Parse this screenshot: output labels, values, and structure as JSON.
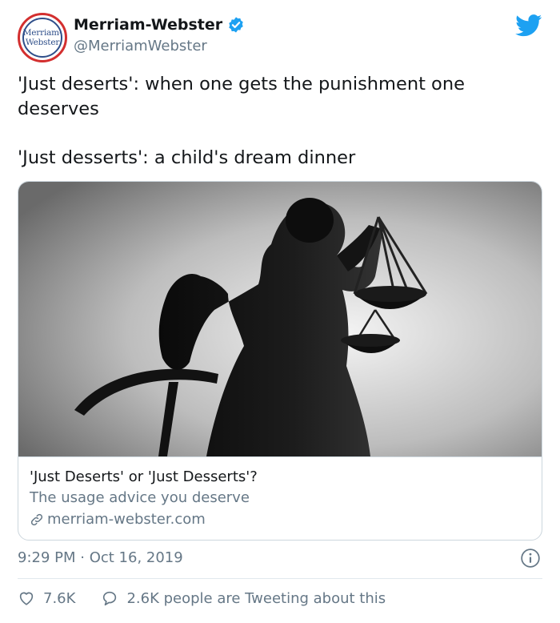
{
  "author": {
    "display_name": "Merriam-Webster",
    "handle": "@MerriamWebster",
    "avatar_line1": "Merriam-",
    "avatar_line2": "Webster",
    "verified": true
  },
  "tweet": {
    "paragraph1": "'Just deserts': when one gets the punishment one deserves",
    "paragraph2": "'Just desserts': a child's dream dinner"
  },
  "card": {
    "image_subject": "silhouette of Lady Justice statue holding scales",
    "title": "'Just Deserts' or 'Just Desserts'?",
    "description": "The usage advice you deserve",
    "domain": "merriam-webster.com"
  },
  "meta": {
    "timestamp": "9:29 PM · Oct 16, 2019"
  },
  "actions": {
    "likes": "7.6K",
    "tweeting": "2.6K people are Tweeting about this"
  },
  "colors": {
    "twitter_blue": "#1da1f2",
    "text_primary": "#14171a",
    "text_secondary": "#657786",
    "border": "#ccd6dd"
  },
  "icons": [
    "verified-badge-icon",
    "twitter-bird-icon",
    "link-icon",
    "info-icon",
    "heart-icon",
    "speech-bubble-icon"
  ]
}
